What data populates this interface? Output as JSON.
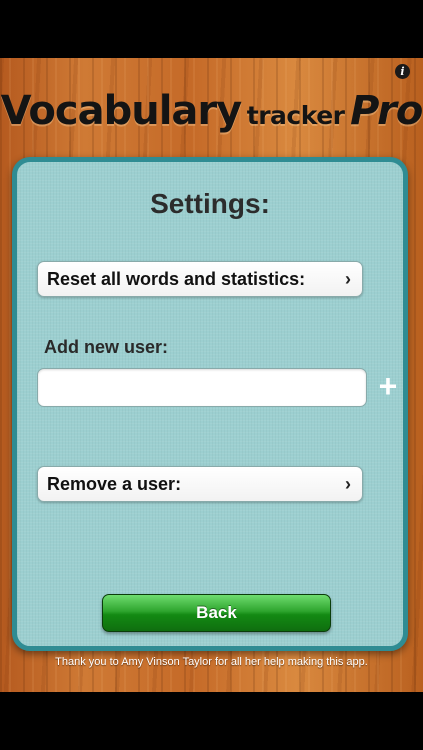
{
  "header": {
    "title_main": "Vocabulary",
    "title_sub": "tracker",
    "title_pro": "Pro",
    "info_icon": "info-icon"
  },
  "settings": {
    "title": "Settings:",
    "reset_label": "Reset all words and statistics:",
    "add_user_label": "Add new user:",
    "new_user_value": "",
    "new_user_placeholder": "",
    "add_icon": "plus-icon",
    "remove_label": "Remove a user:",
    "chevron": "›",
    "back_label": "Back"
  },
  "footer": {
    "credits": "Thank you to Amy Vinson Taylor for all her help making this app."
  },
  "colors": {
    "panel_border": "#2f8c93",
    "panel_fill": "#9ccfd0",
    "back_button": "#1f9a1f",
    "wood": "#c56a28"
  }
}
